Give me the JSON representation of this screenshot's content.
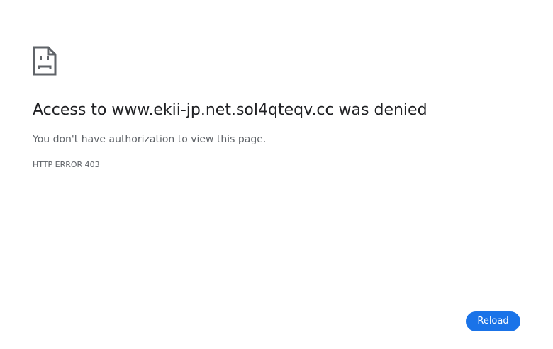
{
  "error": {
    "icon": "sad-page-icon",
    "title": "Access to www.ekii-jp.net.sol4qteqv.cc was denied",
    "message": "You don't have authorization to view this page.",
    "code": "HTTP ERROR 403"
  },
  "actions": {
    "reload_label": "Reload"
  },
  "colors": {
    "accent": "#1a73e8",
    "title_text": "#202124",
    "secondary_text": "#5f6368",
    "icon": "#5f6368"
  }
}
